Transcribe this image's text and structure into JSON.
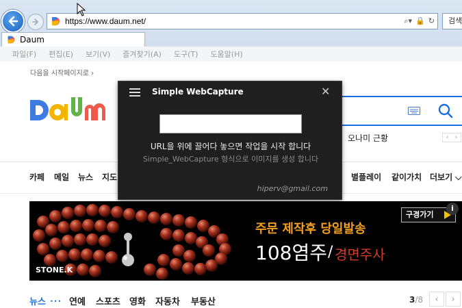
{
  "browser": {
    "address": "https://www.daum.net/",
    "search_placeholder": "검색",
    "tab_title": "Daum",
    "menu": [
      "파일(F)",
      "편집(E)",
      "보기(V)",
      "즐겨찾기(A)",
      "도구(T)",
      "도움말(H)"
    ],
    "address_icons": [
      "search-icon",
      "lock-icon",
      "refresh-icon"
    ]
  },
  "page": {
    "start_page_link": "다음을 시작페이지로 ›",
    "realtime_text": "오나미 근황",
    "realtime_nav": [
      "‹",
      "›"
    ],
    "gnb": [
      "카페",
      "메일",
      "뉴스",
      "지도",
      "별플레이",
      "같이가치",
      "더보기 ⌵"
    ],
    "banner": {
      "brand": "STONE.K",
      "line1": "주문 제작후 당일발송",
      "number": "108염주",
      "slash": "/",
      "sub": "경면주사",
      "button": "구경가기",
      "info": "i"
    },
    "news_tabs": [
      "뉴스",
      "연예",
      "스포츠",
      "영화",
      "자동차",
      "부동산"
    ],
    "news_dots": "•••",
    "page_current": "3",
    "page_total": "/8",
    "news_nav": [
      "‹",
      "›"
    ]
  },
  "capture": {
    "title": "Simple WebCapture",
    "url_input_value": "",
    "message_main": "URL을 위에 끌어다 놓으면 작업을 시작 합니다",
    "message_sub": "Simple_WebCapture 형식으로 이미지를 생성 합니다",
    "email": "hiperv@gmail.com"
  },
  "colors": {
    "accent_blue": "#1a6fe0",
    "capture_bg": "#1f1f1f",
    "banner_orange": "#f2a020",
    "banner_red": "#d23a2a"
  }
}
